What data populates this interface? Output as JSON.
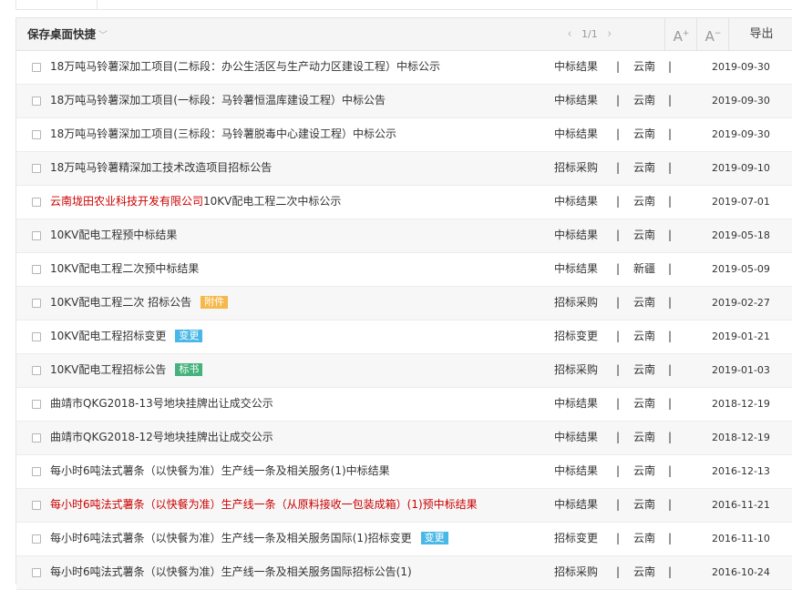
{
  "toolbar": {
    "save_label": "保存桌面快捷",
    "chevron": "﹀",
    "pager_prev": "‹",
    "pager_text": "1/1",
    "pager_next": "›",
    "font_up_label": "A",
    "font_up_sup": "+",
    "font_down_label": "A",
    "font_down_sup": "−",
    "export_label": "导出"
  },
  "rows": [
    {
      "title": "18万吨马铃薯深加工项目(二标段：办公生活区与生产动力区建设工程）中标公示",
      "type": "中标结果",
      "region": "云南",
      "date": "2019-09-30"
    },
    {
      "title": "18万吨马铃薯深加工项目(一标段：马铃薯恒温库建设工程）中标公告",
      "type": "中标结果",
      "region": "云南",
      "date": "2019-09-30"
    },
    {
      "title": "18万吨马铃薯深加工项目(三标段：马铃薯脱毒中心建设工程）中标公示",
      "type": "中标结果",
      "region": "云南",
      "date": "2019-09-30"
    },
    {
      "title": "18万吨马铃薯精深加工技术改造项目招标公告",
      "type": "招标采购",
      "region": "云南",
      "date": "2019-09-10"
    },
    {
      "title_red": "云南垅田农业科技开发有限公司",
      "title": "10KV配电工程二次中标公示",
      "type": "中标结果",
      "region": "云南",
      "date": "2019-07-01"
    },
    {
      "title": "10KV配电工程预中标结果",
      "type": "中标结果",
      "region": "云南",
      "date": "2019-05-18"
    },
    {
      "title": "10KV配电工程二次预中标结果",
      "type": "中标结果",
      "region": "新疆",
      "date": "2019-05-09"
    },
    {
      "title": "10KV配电工程二次 招标公告",
      "tag": "附件",
      "tag_color": "#f5b84a",
      "type": "招标采购",
      "region": "云南",
      "date": "2019-02-27"
    },
    {
      "title": "10KV配电工程招标变更",
      "tag": "变更",
      "tag_color": "#49b8e6",
      "type": "招标变更",
      "region": "云南",
      "date": "2019-01-21"
    },
    {
      "title": "10KV配电工程招标公告",
      "tag": "标书",
      "tag_color": "#43b27c",
      "type": "招标采购",
      "region": "云南",
      "date": "2019-01-03"
    },
    {
      "title": "曲靖市QKG2018-13号地块挂牌出让成交公示",
      "type": "中标结果",
      "region": "云南",
      "date": "2018-12-19"
    },
    {
      "title": "曲靖市QKG2018-12号地块挂牌出让成交公示",
      "type": "中标结果",
      "region": "云南",
      "date": "2018-12-19"
    },
    {
      "title": "每小时6吨法式薯条（以快餐为准）生产线一条及相关服务(1)中标结果",
      "type": "中标结果",
      "region": "云南",
      "date": "2016-12-13"
    },
    {
      "title": "每小时6吨法式薯条（以快餐为准）生产线一条（从原料接收一包装成箱）(1)预中标结果",
      "red": true,
      "type": "中标结果",
      "region": "云南",
      "date": "2016-11-21"
    },
    {
      "title": "每小时6吨法式薯条（以快餐为准）生产线一条及相关服务国际(1)招标变更",
      "tag": "变更",
      "tag_color": "#49b8e6",
      "type": "招标变更",
      "region": "云南",
      "date": "2016-11-10"
    },
    {
      "title": "每小时6吨法式薯条（以快餐为准）生产线一条及相关服务国际招标公告(1)",
      "type": "招标采购",
      "region": "云南",
      "date": "2016-10-24"
    }
  ],
  "separator": "|"
}
